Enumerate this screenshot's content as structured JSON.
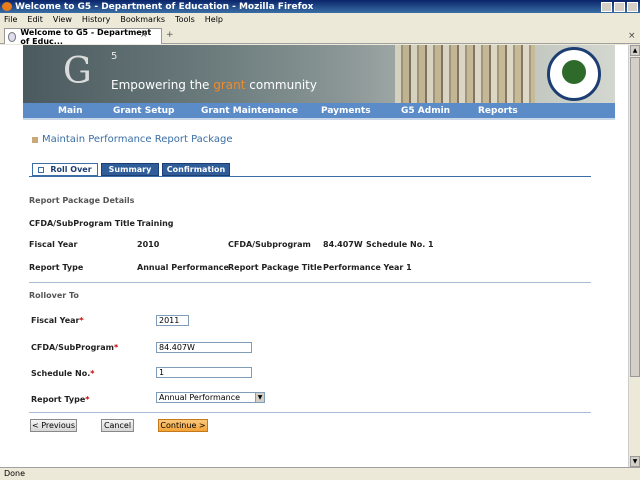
{
  "browser": {
    "title": "Welcome to G5 - Department of Education - Mozilla Firefox",
    "menu": [
      "File",
      "Edit",
      "View",
      "History",
      "Bookmarks",
      "Tools",
      "Help"
    ],
    "tab_title": "Welcome to G5 - Department of Educ...",
    "status": "Done"
  },
  "banner": {
    "logo_g": "G",
    "logo_5": "5",
    "tagline_pre": "Empowering the ",
    "tagline_accent": "grant",
    "tagline_post": " community"
  },
  "nav": [
    "Main",
    "Grant Setup",
    "Grant Maintenance",
    "Payments",
    "G5 Admin",
    "Reports"
  ],
  "page": {
    "title": "Maintain Performance Report Package",
    "tabs": [
      "Roll Over",
      "Summary",
      "Confirmation"
    ]
  },
  "details": {
    "heading": "Report Package Details",
    "cfda_title_label": "CFDA/SubProgram Title",
    "cfda_title_value": "Training",
    "fiscal_year_label": "Fiscal Year",
    "fiscal_year_value": "2010",
    "cfda_sub_label": "CFDA/Subprogram",
    "cfda_sub_value": "84.407W",
    "schedule_label": "Schedule No.",
    "schedule_value": "1",
    "report_type_label": "Report Type",
    "report_type_value": "Annual Performance",
    "package_title_label": "Report Package Title",
    "package_title_value": "Performance Year 1"
  },
  "rollover": {
    "heading": "Rollover To",
    "fiscal_year_label": "Fiscal Year",
    "fiscal_year_value": "2011",
    "cfda_label": "CFDA/SubProgram",
    "cfda_value": "84.407W",
    "schedule_label": "Schedule No.",
    "schedule_value": "1",
    "report_type_label": "Report Type",
    "report_type_value": "Annual Performance",
    "required_marker": "*"
  },
  "buttons": {
    "previous": "< Previous",
    "cancel": "Cancel",
    "continue": "Continue >"
  }
}
